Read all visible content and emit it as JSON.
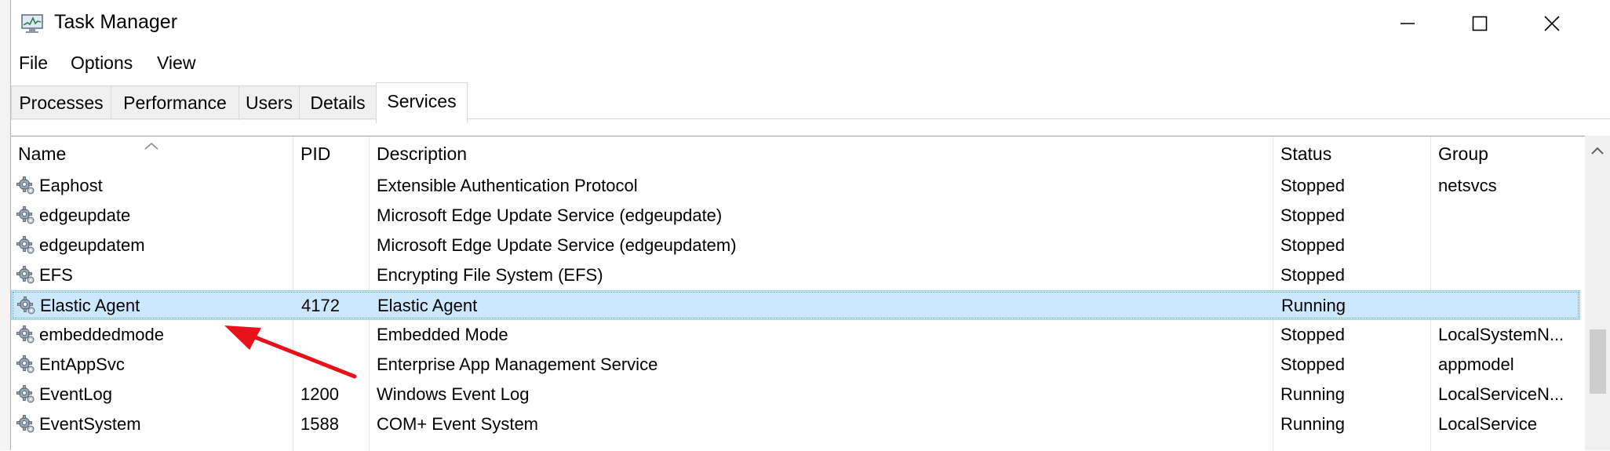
{
  "window": {
    "title": "Task Manager"
  },
  "menu": [
    "File",
    "Options",
    "View"
  ],
  "tabs": [
    {
      "label": "Processes",
      "active": false
    },
    {
      "label": "Performance",
      "active": false
    },
    {
      "label": "Users",
      "active": false
    },
    {
      "label": "Details",
      "active": false
    },
    {
      "label": "Services",
      "active": true
    }
  ],
  "table": {
    "columns": [
      "Name",
      "PID",
      "Description",
      "Status",
      "Group"
    ],
    "sort_column": "Name",
    "selected_row": 4,
    "rows": [
      {
        "name": "Eaphost",
        "pid": "",
        "description": "Extensible Authentication Protocol",
        "status": "Stopped",
        "group": "netsvcs"
      },
      {
        "name": "edgeupdate",
        "pid": "",
        "description": "Microsoft Edge Update Service (edgeupdate)",
        "status": "Stopped",
        "group": ""
      },
      {
        "name": "edgeupdatem",
        "pid": "",
        "description": "Microsoft Edge Update Service (edgeupdatem)",
        "status": "Stopped",
        "group": ""
      },
      {
        "name": "EFS",
        "pid": "",
        "description": "Encrypting File System (EFS)",
        "status": "Stopped",
        "group": ""
      },
      {
        "name": "Elastic Agent",
        "pid": "4172",
        "description": "Elastic Agent",
        "status": "Running",
        "group": ""
      },
      {
        "name": "embeddedmode",
        "pid": "",
        "description": "Embedded Mode",
        "status": "Stopped",
        "group": "LocalSystemN..."
      },
      {
        "name": "EntAppSvc",
        "pid": "",
        "description": "Enterprise App Management Service",
        "status": "Stopped",
        "group": "appmodel"
      },
      {
        "name": "EventLog",
        "pid": "1200",
        "description": "Windows Event Log",
        "status": "Running",
        "group": "LocalServiceN..."
      },
      {
        "name": "EventSystem",
        "pid": "1588",
        "description": "COM+ Event System",
        "status": "Running",
        "group": "LocalService"
      }
    ]
  },
  "icons": {
    "app": "task-manager-icon",
    "row": "service-gear-icon",
    "minimize": "minimize-icon",
    "maximize": "maximize-icon",
    "close": "close-icon"
  },
  "colors": {
    "selection_bg": "#cce8ff",
    "selection_border": "#99d1ff",
    "annotation_arrow": "#e8101a"
  }
}
